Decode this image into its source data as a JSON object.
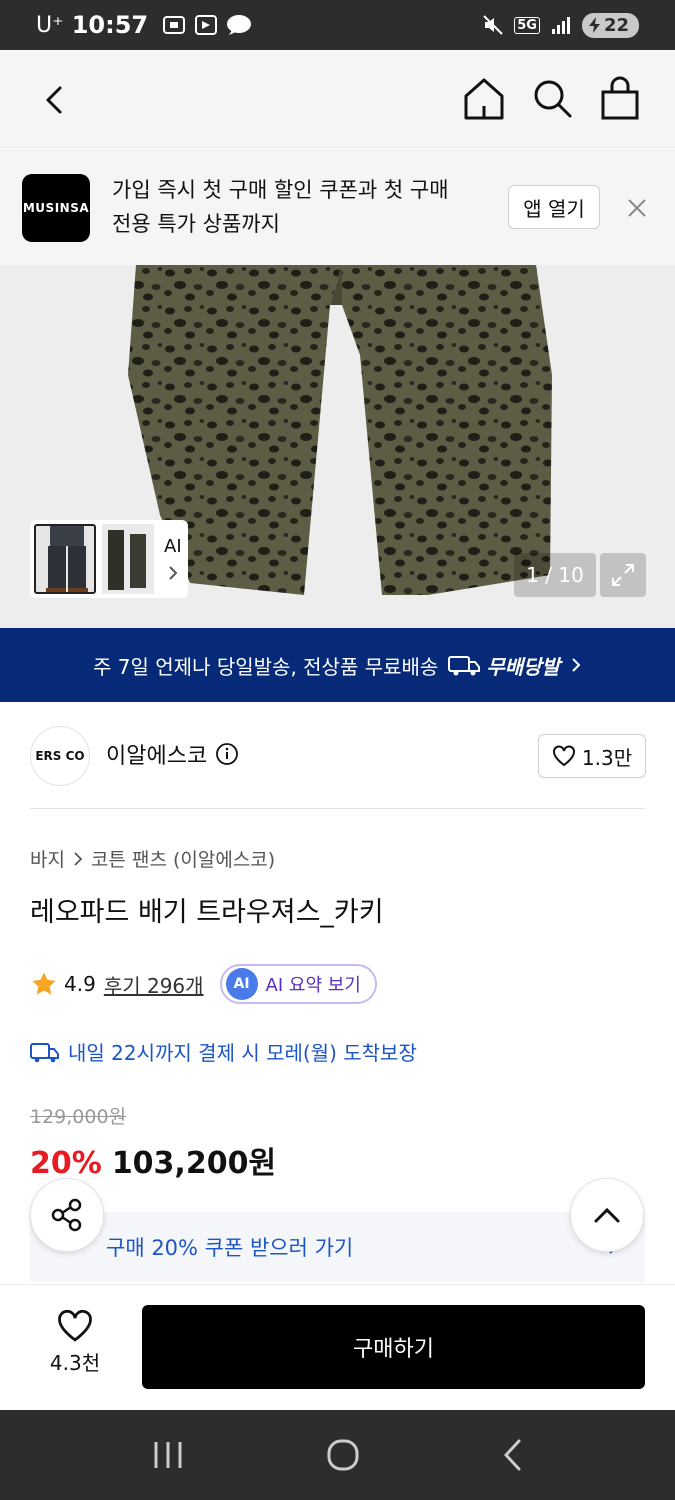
{
  "status_bar": {
    "carrier": "U⁺",
    "time": "10:57",
    "network": "5G",
    "battery": "22"
  },
  "banner": {
    "logo_text": "MUSINSA",
    "message_line1": "가입 즉시 첫 구매 할인 쿠폰과 첫 구매",
    "message_line2": "전용 특가 상품까지",
    "open_app_label": "앱 열기"
  },
  "gallery": {
    "ai_label": "AI",
    "counter": "1 / 10"
  },
  "shipping_strip": {
    "text": "주 7일 언제나 당일발송, 전상품 무료배송",
    "brand": "무배당발"
  },
  "brand": {
    "name": "이알에스코",
    "avatar_text": "ERS CO",
    "likes": "1.3만"
  },
  "breadcrumb": {
    "category": "바지",
    "subcategory": "코튼 팬츠 (이알에스코)"
  },
  "product": {
    "title": "레오파드 배기 트라우져스_카키",
    "rating": "4.9",
    "reviews_label": "후기 296개",
    "ai_badge": "AI",
    "ai_summary_label": "AI 요약 보기",
    "delivery_text": "내일 22시까지 결제 시 모레(월) 도착보장",
    "original_price": "129,000원",
    "discount": "20%",
    "price": "103,200원",
    "coupon_text": "구매 20% 쿠폰 받으러 가기"
  },
  "bottom_bar": {
    "wish_count": "4.3천",
    "buy_label": "구매하기"
  },
  "colors": {
    "navy_strip": "#072a78",
    "discount_red": "#e51c23",
    "link_blue": "#1d55c7",
    "ai_purple": "#5a2fc2"
  }
}
